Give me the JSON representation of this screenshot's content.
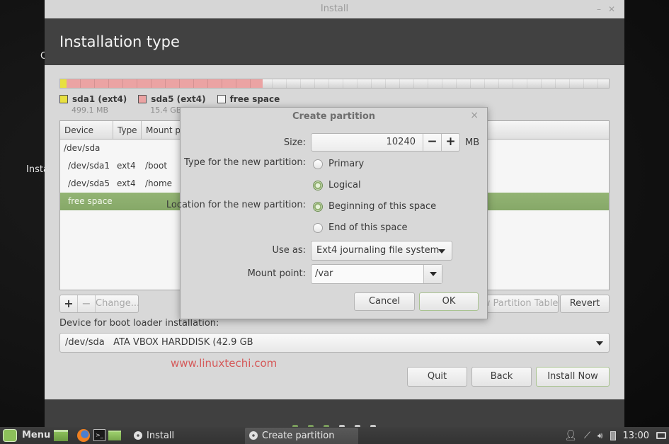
{
  "desktop": {
    "partial_label_top": "C",
    "partial_label_mid": "Insta"
  },
  "window": {
    "title": "Install",
    "minimize_glyph": "–",
    "close_glyph": "✕",
    "heading": "Installation type"
  },
  "partition_bar": {
    "segments": [
      {
        "name": "sda1 (ext4)",
        "fraction": 0.012,
        "color": "#e8e040"
      },
      {
        "name": "sda5 (ext4)",
        "fraction": 0.357,
        "color": "#eba3a3"
      },
      {
        "name": "free space",
        "fraction": 0.631,
        "color": "#f2f2f2"
      }
    ],
    "legend": [
      {
        "label": "sda1 (ext4)",
        "size": "499.1 MB",
        "color": "#e8e040"
      },
      {
        "label": "sda5 (ext4)",
        "size": "15.4 GB",
        "color": "#eba3a3"
      },
      {
        "label": "free space",
        "size": "",
        "color": "#f6f6f6"
      }
    ]
  },
  "table": {
    "columns": [
      "Device",
      "Type",
      "Mount point"
    ],
    "rows": [
      {
        "device": "/dev/sda",
        "type": "",
        "mount": ""
      },
      {
        "device": "/dev/sda1",
        "type": "ext4",
        "mount": "/boot"
      },
      {
        "device": "/dev/sda5",
        "type": "ext4",
        "mount": "/home"
      },
      {
        "device": "free space",
        "type": "",
        "mount": "",
        "selected": true
      }
    ]
  },
  "actions": {
    "add": "+",
    "remove": "−",
    "change": "Change...",
    "new_table": "New Partition Table...",
    "revert": "Revert"
  },
  "bootloader": {
    "label": "Device for boot loader installation:",
    "value": "/dev/sda   ATA VBOX HARDDISK (42.9 GB"
  },
  "watermark": "www.linuxtechi.com",
  "nav": {
    "quit": "Quit",
    "back": "Back",
    "install_now": "Install Now"
  },
  "progress": {
    "steps_total": 6,
    "steps_done": 3
  },
  "dialog": {
    "title": "Create partition",
    "close_glyph": "×",
    "size_label": "Size:",
    "size_value": "10240",
    "size_unit": "MB",
    "minus": "−",
    "plus": "+",
    "type_label": "Type for the new partition:",
    "type_options": [
      {
        "label": "Primary",
        "checked": false
      },
      {
        "label": "Logical",
        "checked": true
      }
    ],
    "location_label": "Location for the new partition:",
    "location_options": [
      {
        "label": "Beginning of this space",
        "checked": true
      },
      {
        "label": "End of this space",
        "checked": false
      }
    ],
    "use_as_label": "Use as:",
    "use_as_value": "Ext4 journaling file system",
    "mount_label": "Mount point:",
    "mount_value": "/var",
    "cancel": "Cancel",
    "ok": "OK"
  },
  "taskbar": {
    "menu_label": "Menu",
    "tasks": [
      {
        "label": "Install",
        "active": false
      },
      {
        "label": "Create partition",
        "active": true
      }
    ],
    "clock": "13:00"
  }
}
